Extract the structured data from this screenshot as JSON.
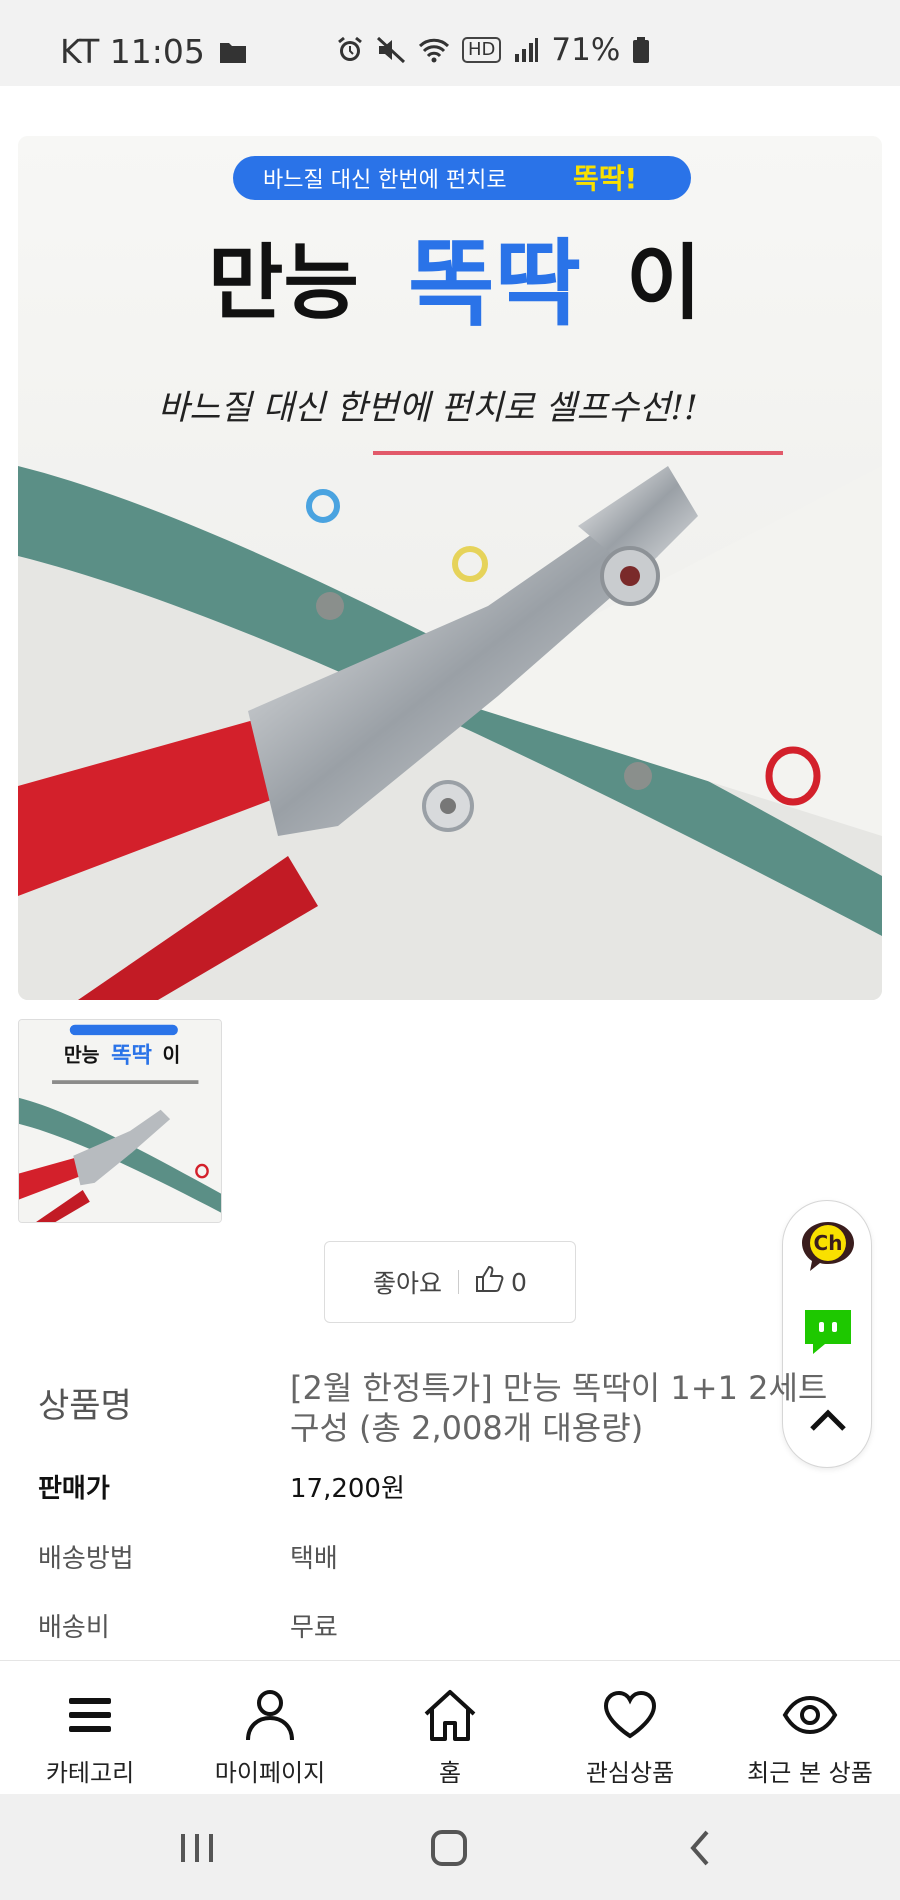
{
  "status_bar": {
    "carrier_time": "KT 11:05",
    "battery": "71%",
    "hd": "HD"
  },
  "product": {
    "image": {
      "banner_text": "바느질 대신 한번에 펀치로",
      "banner_highlight": "똑딱!",
      "title_prefix": "만능",
      "title_highlight": "똑딱",
      "title_suffix": "이",
      "tagline": "바느질 대신 한번에 펀치로 셀프수선!!"
    },
    "like_label": "좋아요",
    "like_count": "0",
    "info": {
      "name_label": "상품명",
      "name_value": "[2월 한정특가] 만능 똑딱이 1+1 2세트 구성 (총 2,008개 대용량)",
      "price_label": "판매가",
      "price_value": "17,200원",
      "shipping_method_label": "배송방법",
      "shipping_method_value": "택배",
      "shipping_fee_label": "배송비",
      "shipping_fee_value": "무료"
    }
  },
  "float_widget": {
    "kakao_label": "Ch"
  },
  "bottom_nav": {
    "items": [
      {
        "label": "카테고리",
        "icon": "menu-icon"
      },
      {
        "label": "마이페이지",
        "icon": "person-icon"
      },
      {
        "label": "홈",
        "icon": "home-icon"
      },
      {
        "label": "관심상품",
        "icon": "heart-icon"
      },
      {
        "label": "최근 본 상품",
        "icon": "eye-icon"
      }
    ]
  },
  "colors": {
    "accent_blue": "#2a73e8",
    "kakao_yellow": "#f9e000",
    "talk_green": "#1ec800",
    "handle_red": "#d3202b",
    "fabric_teal": "#5b8f86"
  }
}
